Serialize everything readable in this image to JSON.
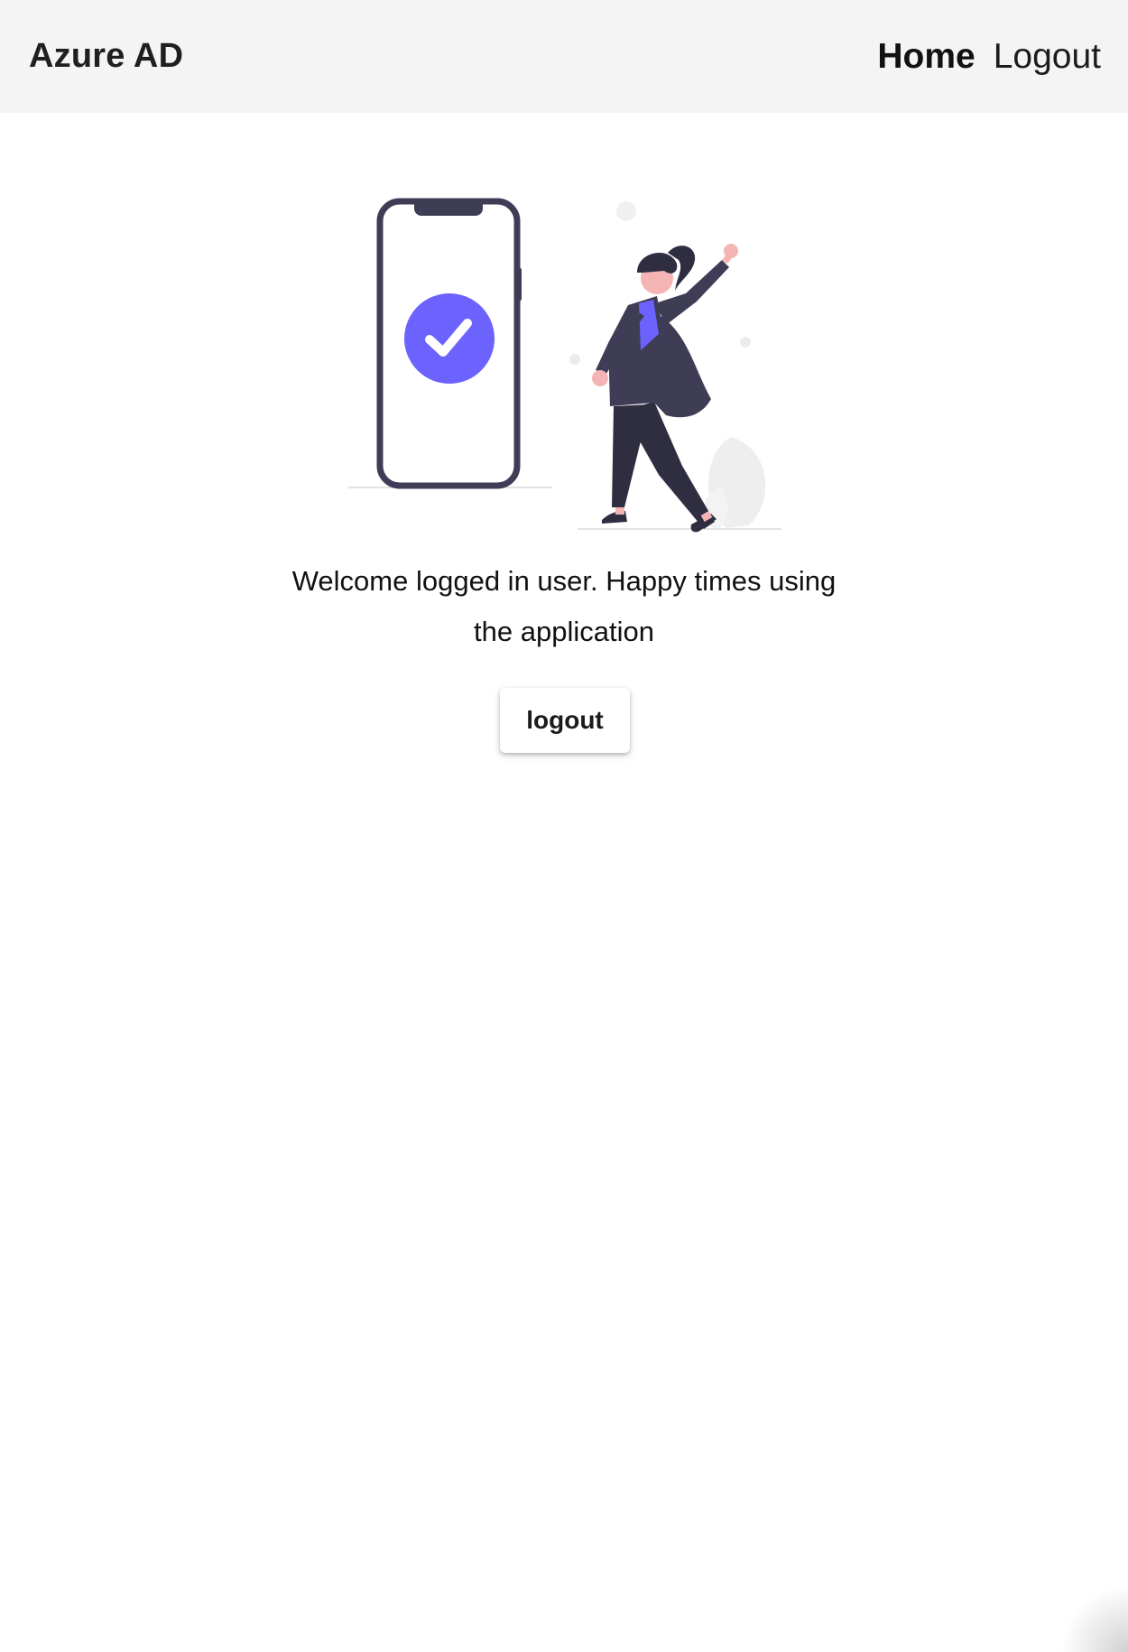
{
  "header": {
    "brand": "Azure AD",
    "nav": {
      "home_label": "Home",
      "logout_label": "Logout"
    }
  },
  "main": {
    "illustration": {
      "icon": "phone-check-illustration",
      "accent_color": "#6c63ff",
      "dark_color": "#3f3d56",
      "skin_color": "#f4b4b4"
    },
    "welcome_line1": "Welcome logged in user. Happy times using",
    "welcome_line2": "the application",
    "logout_button_label": "logout"
  }
}
